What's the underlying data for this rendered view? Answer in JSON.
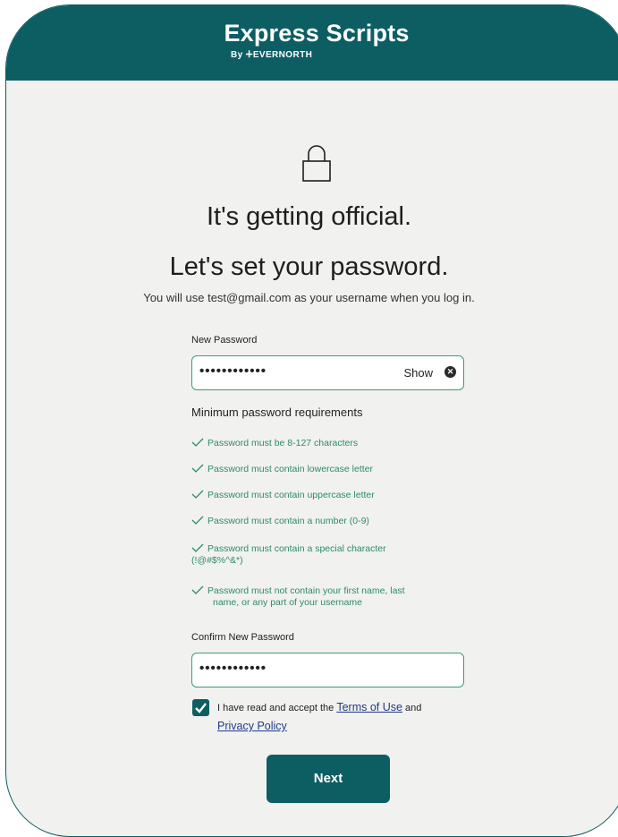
{
  "brand": {
    "title": "Express Scripts",
    "subtitle": "By ⵜEVERNORTH"
  },
  "heading": {
    "line1": "It's getting official.",
    "line2": "Let's set your password."
  },
  "intro": "You will use test@gmail.com as your username when you log in.",
  "new_password": {
    "label": "New Password",
    "value": "••••••••••••",
    "show_label": "Show"
  },
  "requirements": {
    "title": "Minimum password requirements",
    "items": [
      "Password must be 8-127 characters",
      "Password must contain lowercase letter",
      "Password must contain uppercase letter",
      "Password must contain a number (0-9)",
      "Password must contain a special character",
      "(!@#$%^&*)",
      "Password must not contain your first name, last",
      "name, or any part of your username"
    ]
  },
  "confirm_password": {
    "label": "Confirm New Password",
    "value": "••••••••••••"
  },
  "terms": {
    "prefix": "I have read and accept the ",
    "terms_link": "Terms of Use",
    "middle": " and ",
    "privacy_link": "Privacy Policy",
    "checked": true
  },
  "next_button": "Next",
  "colors": {
    "brand_teal": "#0c5e63",
    "success_green": "#2e8b6a",
    "background": "#f1f1ef"
  }
}
